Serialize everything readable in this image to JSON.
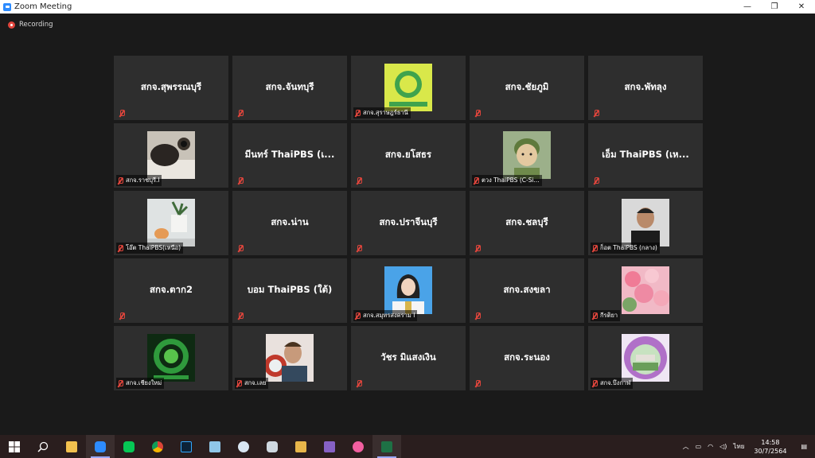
{
  "window": {
    "title": "Zoom Meeting",
    "minimize": "—",
    "restore": "❐",
    "close": "✕"
  },
  "recording": {
    "label": "Recording"
  },
  "tiles": [
    {
      "type": "text",
      "name": "สกจ.สุพรรณบุรี"
    },
    {
      "type": "text",
      "name": "สกจ.จันทบุรี"
    },
    {
      "type": "pic",
      "label": "สกจ.สุราษฎร์ธานี",
      "pic": "logo-green"
    },
    {
      "type": "text",
      "name": "สกจ.ชัยภูมิ"
    },
    {
      "type": "text",
      "name": "สกจ.พัทลุง"
    },
    {
      "type": "pic",
      "label": "สกจ.ราชบุรี.l",
      "pic": "cat"
    },
    {
      "type": "text",
      "name": "มีนทร์ ThaiPBS (เ..."
    },
    {
      "type": "text",
      "name": "สกจ.ยโสธร"
    },
    {
      "type": "pic",
      "label": "ตวง ThaiPBS (C-Si...",
      "pic": "cartoon"
    },
    {
      "type": "text",
      "name": "เอ็ม ThaiPBS (เห..."
    },
    {
      "type": "pic",
      "label": "โอ๊ต ThaiPBS(เหนือ)",
      "pic": "plant"
    },
    {
      "type": "text",
      "name": "สกจ.น่าน"
    },
    {
      "type": "text",
      "name": "สกจ.ปราจีนบุรี"
    },
    {
      "type": "text",
      "name": "สกจ.ชลบุรี"
    },
    {
      "type": "pic",
      "label": "ก็อต ThaiPBS (กลาง)",
      "pic": "man"
    },
    {
      "type": "text",
      "name": "สกจ.ตาก2"
    },
    {
      "type": "text",
      "name": "บอม ThaiPBS (ใต้)"
    },
    {
      "type": "pic",
      "label": "สกจ.สมุทรสงคราม l",
      "pic": "woman"
    },
    {
      "type": "text",
      "name": "สกจ.สงขลา"
    },
    {
      "type": "pic",
      "label": "กีรติยา",
      "pic": "flowers"
    },
    {
      "type": "pic",
      "label": "สกจ.เชียงใหม่",
      "pic": "logo-dark"
    },
    {
      "type": "pic",
      "label": "สกจ.เลย",
      "pic": "captain"
    },
    {
      "type": "text",
      "name": "วัชร มิแสงเงิน"
    },
    {
      "type": "text",
      "name": "สกจ.ระนอง"
    },
    {
      "type": "pic",
      "label": "สกจ.บึงกาฬ",
      "pic": "logo-round"
    }
  ],
  "taskbar": {
    "apps": [
      "start-icon",
      "search-icon",
      "file-explorer-icon",
      "zoom-icon",
      "line-icon",
      "chrome-icon",
      "photoshop-icon",
      "notepad-icon",
      "paint-icon",
      "app-icon",
      "beer-icon",
      "visual-studio-icon",
      "itunes-icon",
      "excel-icon"
    ],
    "ime": "ไทย",
    "time": "14:58",
    "date": "30/7/2564"
  }
}
